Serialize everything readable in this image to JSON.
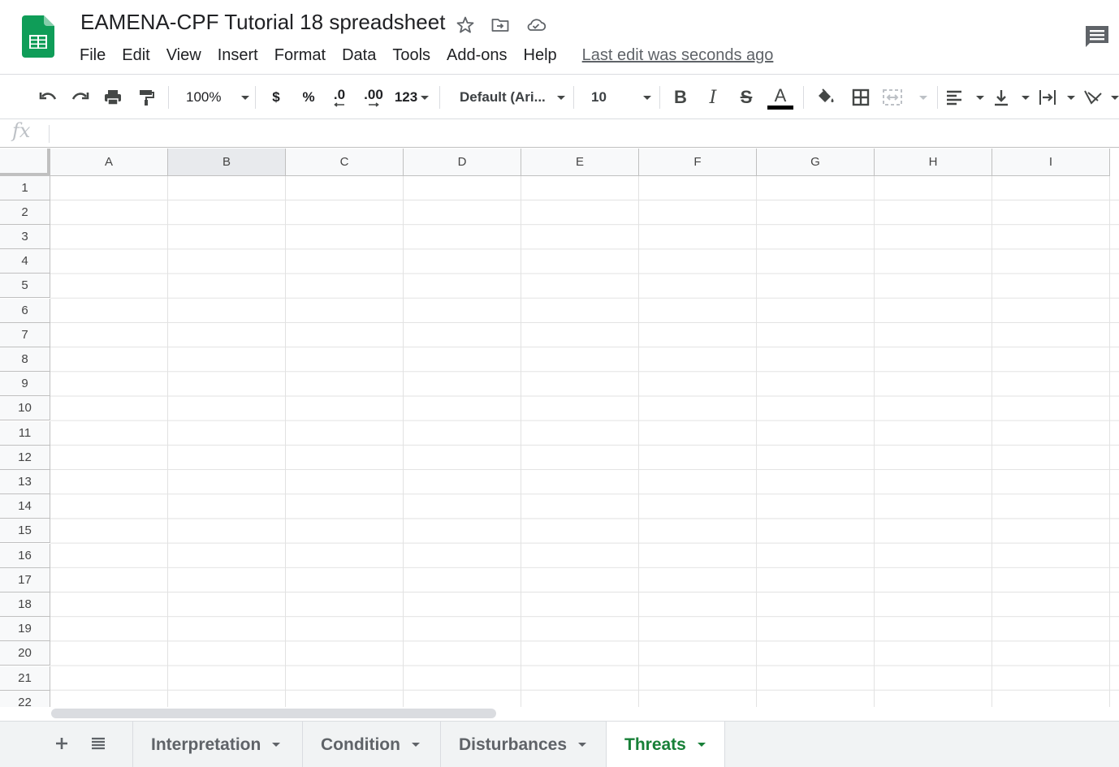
{
  "doc": {
    "title": "EAMENA-CPF Tutorial 18 spreadsheet",
    "last_edit": "Last edit was seconds ago",
    "brand_color": "#0f9d58"
  },
  "menu": [
    "File",
    "Edit",
    "View",
    "Insert",
    "Format",
    "Data",
    "Tools",
    "Add-ons",
    "Help"
  ],
  "toolbar": {
    "zoom": "100%",
    "currency": "$",
    "percent": "%",
    "decrease_decimal": ".0",
    "increase_decimal": ".00",
    "more_formats": "123",
    "font": "Default (Ari...",
    "font_size": "10",
    "bold": "B",
    "italic": "I",
    "strikethrough": "S",
    "text_color_letter": "A",
    "text_color": "#000000"
  },
  "formula_bar": {
    "fx_label": "fx",
    "value": ""
  },
  "grid": {
    "columns": [
      "A",
      "B",
      "C",
      "D",
      "E",
      "F",
      "G",
      "H",
      "I"
    ],
    "selected_column": "B",
    "rows": [
      "1",
      "2",
      "3",
      "4",
      "5",
      "6",
      "7",
      "8",
      "9",
      "10",
      "11",
      "12",
      "13",
      "14",
      "15",
      "16",
      "17",
      "18",
      "19",
      "20",
      "21",
      "22"
    ]
  },
  "sheets": [
    {
      "label": "Interpretation",
      "active": false
    },
    {
      "label": "Condition",
      "active": false
    },
    {
      "label": "Disturbances",
      "active": false
    },
    {
      "label": "Threats",
      "active": true
    }
  ],
  "accent_color": "#188038"
}
